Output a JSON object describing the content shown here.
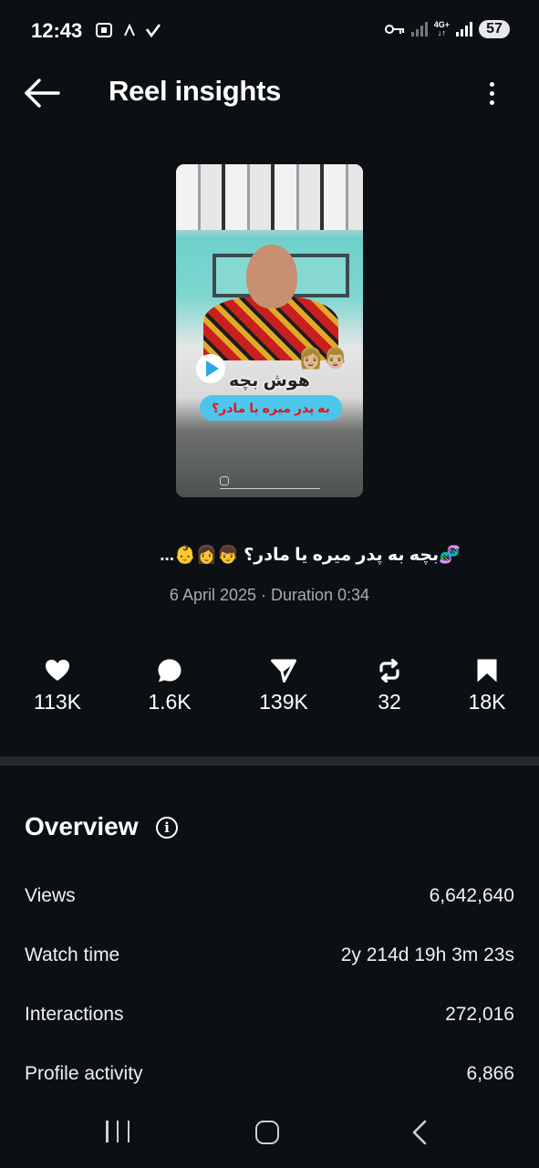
{
  "status_bar": {
    "time": "12:43",
    "left_icons": [
      "screenshot-icon",
      "chevron-up-icon",
      "check-icon"
    ],
    "right_icons": [
      "vpn-key-icon",
      "signal-icon",
      "network-4g-icon",
      "signal-icon"
    ],
    "network": "4G+",
    "battery": "57"
  },
  "header": {
    "title": "Reel insights",
    "back_icon": "back-arrow-icon",
    "menu_icon": "more-vertical-icon"
  },
  "reel": {
    "thumbnail_headline": "هوش بچه",
    "thumbnail_subline": "به پدر میره یا مادر؟",
    "thumbnail_faces": "👩🏼👨🏼",
    "caption": "🧬بچه به پدر میره یا مادر؟ 👦👩👶...",
    "meta": "6 April 2025 · Duration 0:34"
  },
  "stats": [
    {
      "icon": "heart-icon",
      "value": "113K"
    },
    {
      "icon": "comment-icon",
      "value": "1.6K"
    },
    {
      "icon": "share-icon",
      "value": "139K"
    },
    {
      "icon": "repost-icon",
      "value": "32"
    },
    {
      "icon": "save-icon",
      "value": "18K"
    }
  ],
  "overview": {
    "title": "Overview",
    "info_icon": "info-icon",
    "rows": [
      {
        "label": "Views",
        "value": "6,642,640"
      },
      {
        "label": "Watch time",
        "value": "2y 214d 19h 3m 23s"
      },
      {
        "label": "Interactions",
        "value": "272,016"
      },
      {
        "label": "Profile activity",
        "value": "6,866"
      }
    ]
  },
  "nav_bar": {
    "items": [
      "recents-icon",
      "home-icon",
      "back-icon"
    ]
  }
}
